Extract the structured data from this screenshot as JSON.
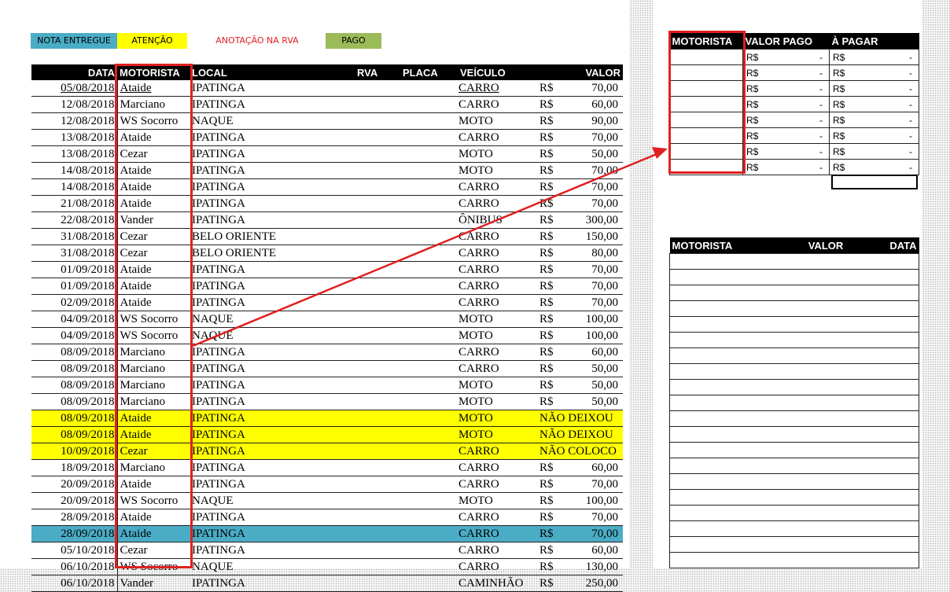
{
  "legend": {
    "delivered": {
      "label": "NOTA ENTREGUE",
      "color": "#4bacc6"
    },
    "attention": {
      "label": "ATENÇÃO",
      "color": "#ffff00"
    },
    "rva_note": {
      "label": "ANOTAÇÃO NA RVA",
      "color": "#ff0000"
    },
    "paid": {
      "label": "PAGO",
      "color": "#9bbb59"
    }
  },
  "main_table": {
    "headers": {
      "data": "DATA",
      "motorista": "MOTORISTA",
      "local": "LOCAL",
      "rva": "RVA",
      "placa": "PLACA",
      "veiculo": "VEÍCULO",
      "valor": "VALOR"
    },
    "rows": [
      {
        "data": "05/08/2018",
        "motorista": "Ataide",
        "local": "IPATINGA",
        "veiculo": "CARRO",
        "cur": "R$",
        "valor": "70,00"
      },
      {
        "data": "12/08/2018",
        "motorista": "Marciano",
        "local": "IPATINGA",
        "veiculo": "CARRO",
        "cur": "R$",
        "valor": "60,00"
      },
      {
        "data": "12/08/2018",
        "motorista": "WS Socorro",
        "local": "NAQUE",
        "veiculo": "MOTO",
        "cur": "R$",
        "valor": "90,00"
      },
      {
        "data": "13/08/2018",
        "motorista": "Ataide",
        "local": "IPATINGA",
        "veiculo": "CARRO",
        "cur": "R$",
        "valor": "70,00"
      },
      {
        "data": "13/08/2018",
        "motorista": "Cezar",
        "local": "IPATINGA",
        "veiculo": "MOTO",
        "cur": "R$",
        "valor": "50,00"
      },
      {
        "data": "14/08/2018",
        "motorista": "Ataide",
        "local": "IPATINGA",
        "veiculo": "MOTO",
        "cur": "R$",
        "valor": "70,00"
      },
      {
        "data": "14/08/2018",
        "motorista": "Ataide",
        "local": "IPATINGA",
        "veiculo": "CARRO",
        "cur": "R$",
        "valor": "70,00"
      },
      {
        "data": "21/08/2018",
        "motorista": "Ataide",
        "local": "IPATINGA",
        "veiculo": "CARRO",
        "cur": "R$",
        "valor": "70,00"
      },
      {
        "data": "22/08/2018",
        "motorista": "Vander",
        "local": "IPATINGA",
        "veiculo": "ÔNIBUS",
        "cur": "R$",
        "valor": "300,00"
      },
      {
        "data": "31/08/2018",
        "motorista": "Cezar",
        "local": "BELO ORIENTE",
        "veiculo": "CARRO",
        "cur": "R$",
        "valor": "150,00"
      },
      {
        "data": "31/08/2018",
        "motorista": "Cezar",
        "local": "BELO ORIENTE",
        "veiculo": "CARRO",
        "cur": "R$",
        "valor": "80,00"
      },
      {
        "data": "01/09/2018",
        "motorista": "Ataide",
        "local": "IPATINGA",
        "veiculo": "CARRO",
        "cur": "R$",
        "valor": "70,00"
      },
      {
        "data": "01/09/2018",
        "motorista": "Ataide",
        "local": "IPATINGA",
        "veiculo": "CARRO",
        "cur": "R$",
        "valor": "70,00"
      },
      {
        "data": "02/09/2018",
        "motorista": "Ataide",
        "local": "IPATINGA",
        "veiculo": "CARRO",
        "cur": "R$",
        "valor": "70,00"
      },
      {
        "data": "04/09/2018",
        "motorista": "WS Socorro",
        "local": "NAQUE",
        "veiculo": "MOTO",
        "cur": "R$",
        "valor": "100,00"
      },
      {
        "data": "04/09/2018",
        "motorista": "WS Socorro",
        "local": "NAQUE",
        "veiculo": "MOTO",
        "cur": "R$",
        "valor": "100,00"
      },
      {
        "data": "08/09/2018",
        "motorista": "Marciano",
        "local": "IPATINGA",
        "veiculo": "CARRO",
        "cur": "R$",
        "valor": "60,00"
      },
      {
        "data": "08/09/2018",
        "motorista": "Marciano",
        "local": "IPATINGA",
        "veiculo": "CARRO",
        "cur": "R$",
        "valor": "50,00"
      },
      {
        "data": "08/09/2018",
        "motorista": "Marciano",
        "local": "IPATINGA",
        "veiculo": "MOTO",
        "cur": "R$",
        "valor": "50,00"
      },
      {
        "data": "08/09/2018",
        "motorista": "Marciano",
        "local": "IPATINGA",
        "veiculo": "MOTO",
        "cur": "R$",
        "valor": "50,00"
      },
      {
        "data": "08/09/2018",
        "motorista": "Ataide",
        "local": "IPATINGA",
        "veiculo": "MOTO",
        "cur": "NÃO DEIXOU",
        "valor": "",
        "status": "attention"
      },
      {
        "data": "08/09/2018",
        "motorista": "Ataide",
        "local": "IPATINGA",
        "veiculo": "MOTO",
        "cur": "NÃO DEIXOU",
        "valor": "",
        "status": "attention"
      },
      {
        "data": "10/09/2018",
        "motorista": "Cezar",
        "local": "IPATINGA",
        "veiculo": "CARRO",
        "cur": "NÃO COLOCO",
        "valor": "",
        "status": "attention"
      },
      {
        "data": "18/09/2018",
        "motorista": "Marciano",
        "local": "IPATINGA",
        "veiculo": "CARRO",
        "cur": "R$",
        "valor": "60,00"
      },
      {
        "data": "20/09/2018",
        "motorista": "Ataide",
        "local": "IPATINGA",
        "veiculo": "CARRO",
        "cur": "R$",
        "valor": "70,00"
      },
      {
        "data": "20/09/2018",
        "motorista": "WS Socorro",
        "local": "NAQUE",
        "veiculo": "MOTO",
        "cur": "R$",
        "valor": "100,00"
      },
      {
        "data": "28/09/2018",
        "motorista": "Ataide",
        "local": "IPATINGA",
        "veiculo": "CARRO",
        "cur": "R$",
        "valor": "70,00"
      },
      {
        "data": "28/09/2018",
        "motorista": "Ataide",
        "local": "IPATINGA",
        "veiculo": "CARRO",
        "cur": "R$",
        "valor": "70,00",
        "status": "delivered"
      },
      {
        "data": "05/10/2018",
        "motorista": "Cezar",
        "local": "IPATINGA",
        "veiculo": "CARRO",
        "cur": "R$",
        "valor": "60,00"
      },
      {
        "data": "06/10/2018",
        "motorista": "WS Socorro",
        "local": "NAQUE",
        "veiculo": "CARRO",
        "cur": "R$",
        "valor": "130,00"
      },
      {
        "data": "06/10/2018",
        "motorista": "Vander",
        "local": "IPATINGA",
        "veiculo": "CAMINHÃO",
        "cur": "R$",
        "valor": "250,00"
      }
    ]
  },
  "summary_table": {
    "headers": {
      "motorista": "MOTORISTA",
      "valor_pago": "VALOR PAGO",
      "a_pagar": "À PAGAR"
    },
    "rows": [
      {
        "motorista": "",
        "pago_cur": "R$",
        "pago_val": "-",
        "pagar_cur": "R$",
        "pagar_val": "-"
      },
      {
        "motorista": "",
        "pago_cur": "R$",
        "pago_val": "-",
        "pagar_cur": "R$",
        "pagar_val": "-"
      },
      {
        "motorista": "",
        "pago_cur": "R$",
        "pago_val": "-",
        "pagar_cur": "R$",
        "pagar_val": "-"
      },
      {
        "motorista": "",
        "pago_cur": "R$",
        "pago_val": "-",
        "pagar_cur": "R$",
        "pagar_val": "-"
      },
      {
        "motorista": "",
        "pago_cur": "R$",
        "pago_val": "-",
        "pagar_cur": "R$",
        "pagar_val": "-"
      },
      {
        "motorista": "",
        "pago_cur": "R$",
        "pago_val": "-",
        "pagar_cur": "R$",
        "pagar_val": "-"
      },
      {
        "motorista": "",
        "pago_cur": "R$",
        "pago_val": "-",
        "pagar_cur": "R$",
        "pagar_val": "-"
      },
      {
        "motorista": "",
        "pago_cur": "R$",
        "pago_val": "-",
        "pagar_cur": "R$",
        "pagar_val": "-"
      }
    ]
  },
  "payments_table": {
    "headers": {
      "motorista": "MOTORISTA",
      "valor": "VALOR",
      "data": "DATA"
    },
    "empty_rows": 20
  },
  "annotation": {
    "color": "#e02020"
  }
}
